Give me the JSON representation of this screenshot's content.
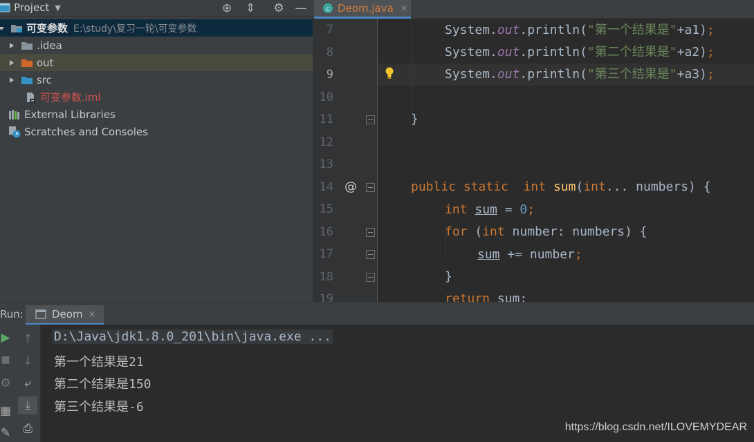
{
  "project_panel": {
    "title": "Project",
    "root": {
      "name": "可变参数",
      "path": "E:\\study\\复习一轮\\可变参数"
    },
    "items": [
      {
        "label": ".idea"
      },
      {
        "label": "out"
      },
      {
        "label": "src"
      },
      {
        "label": "可变参数.iml"
      },
      {
        "label": "External Libraries"
      },
      {
        "label": "Scratches and Consoles"
      }
    ]
  },
  "editor": {
    "tab_label": "Deom.java",
    "tab_close": "×",
    "line_numbers": [
      "7",
      "8",
      "9",
      "10",
      "11",
      "12",
      "13",
      "14",
      "15",
      "16",
      "17",
      "18",
      "19"
    ],
    "current_line": "9",
    "annotation_mark": "@",
    "code": {
      "l7_prefix": "System.",
      "l7_out": "out",
      "l7_call": ".println(",
      "l7_str": "\"第一个结果是\"",
      "l7_tail": "+a1)",
      "l8_str": "\"第二个结果是\"",
      "l8_tail": "+a2)",
      "l9_str": "\"第三个结果是\"",
      "l9_tail": "+a3)",
      "semi": ";",
      "brace_close": "}",
      "kw_public": "public",
      "kw_static": "static",
      "kw_int": "int",
      "fn_sum": "sum",
      "l14_params": "(",
      "l14_params2": "... numbers) {",
      "var_sum": "sum",
      "l15_eq": " = ",
      "l15_zero": "0",
      "kw_for": "for",
      "l16_rest": " (",
      "l16_rest2": " number: numbers) {",
      "l17_op": " += number",
      "kw_return": "return",
      "l19_sum": " sum;"
    }
  },
  "run_panel": {
    "label": "Run:",
    "tab_label": "Deom",
    "tab_close": "×",
    "console": [
      "D:\\Java\\jdk1.8.0_201\\bin\\java.exe ...",
      "第一个结果是21",
      "第二个结果是150",
      "第三个结果是-6"
    ]
  },
  "watermark": "https://blog.csdn.net/ILOVEMYDEAR",
  "colors": {
    "keyword": "#cc7832",
    "string": "#6a8759",
    "number": "#6897bb",
    "static_field": "#9876aa",
    "function": "#ffc66d",
    "selection": "#0d293e",
    "accent": "#4a88c7"
  }
}
